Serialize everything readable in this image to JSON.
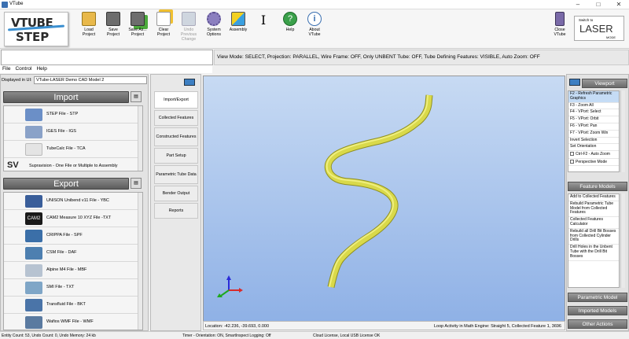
{
  "window": {
    "title": "VTube"
  },
  "logo": {
    "line1": "VTUBE",
    "line2": "STEP"
  },
  "toolbar": {
    "buttons": [
      {
        "line1": "Load",
        "line2": "Project",
        "disabled": false
      },
      {
        "line1": "Save",
        "line2": "Project",
        "disabled": false
      },
      {
        "line1": "Save As...",
        "line2": "Project",
        "disabled": false
      },
      {
        "line1": "Clear",
        "line2": "Project",
        "disabled": false
      },
      {
        "line1": "Undo",
        "line2": "Previous",
        "line3": "Change",
        "disabled": true
      },
      {
        "line1": "System",
        "line2": "Options",
        "disabled": false
      },
      {
        "line1": "Assembly",
        "line2": "",
        "disabled": false
      },
      {
        "line1": "I",
        "line2": "",
        "disabled": false
      },
      {
        "line1": "Help",
        "line2": "",
        "disabled": false
      },
      {
        "line1": "About",
        "line2": "VTube",
        "disabled": false
      }
    ],
    "close": {
      "line1": "Close",
      "line2": "VTube"
    },
    "switch_logo": {
      "top": "Switch to",
      "main": "LASER",
      "bottom": "MODE"
    }
  },
  "view_status": "View Mode: SELECT, Projection: PARALLEL, Wire Frame: OFF, Only UNBENT Tube: OFF, Tube Defining Features: VISIBLE, Auto Zoom: OFF",
  "menu": [
    "File",
    "Control",
    "Help"
  ],
  "displayed": {
    "label": "Displayed in UI:",
    "value": "VTube-LASER Demo CAD Model 2"
  },
  "import": {
    "title": "Import",
    "items": [
      {
        "label": "STEP File - STP",
        "color": "#6b8fc7"
      },
      {
        "label": "IGES File - IGS",
        "color": "#8aa2c8"
      },
      {
        "label": "TubeCalc File - TCA",
        "color": "#c9c9c9"
      },
      {
        "label": "Supravision - One File or Multiple to Assembly",
        "color": "#222222"
      }
    ]
  },
  "export": {
    "title": "Export",
    "items": [
      {
        "label": "UNISON Unibend v11 File - YBC",
        "color": "#3a5e9a"
      },
      {
        "label": "CAM2 Measure 10 XYZ File -TXT",
        "color": "#1a1a1a"
      },
      {
        "label": "CRIPPA File - SPF",
        "color": "#3b6fa8"
      },
      {
        "label": "CSM File - DAF",
        "color": "#4d7fb0"
      },
      {
        "label": "Alpine M4 File - MBF",
        "color": "#b7c3d1"
      },
      {
        "label": "SMI File - TXT",
        "color": "#7fa6c7"
      },
      {
        "label": "Transfluid File - BKT",
        "color": "#4a74a8"
      },
      {
        "label": "Wafios WMF File - WMF",
        "color": "#5a7aa0"
      }
    ]
  },
  "middle_tabs": [
    "Import/Export",
    "Collected Features",
    "Constructed Features",
    "Part Setup",
    "Parametric Tube Data",
    "Bender Output",
    "Reports"
  ],
  "viewport": {
    "location": "Location: -42.236, -39.693, 0.000",
    "loop": "Loop Activity in Math Engine: Straight 5, Collected Feature 1, 3696"
  },
  "viewport_panel": {
    "title": "Viewport",
    "items": [
      {
        "label": "F2 - Refresh Parametric Graphics",
        "highlight": true,
        "checkbox": false
      },
      {
        "label": "F3 - Zoom All",
        "highlight": false,
        "checkbox": false
      },
      {
        "label": "F4 - VPort: Select",
        "highlight": false,
        "checkbox": false
      },
      {
        "label": "F5 - VPort: Orbit",
        "highlight": false,
        "checkbox": false
      },
      {
        "label": "F6 - VPort: Pan",
        "highlight": false,
        "checkbox": false
      },
      {
        "label": "F7 - VPort: Zoom Win",
        "highlight": false,
        "checkbox": false
      },
      {
        "label": "Invert Selection",
        "highlight": false,
        "checkbox": false
      },
      {
        "label": "Set Orientation",
        "highlight": false,
        "checkbox": false
      },
      {
        "label": "Ctrl-F2 - Auto Zoom",
        "highlight": false,
        "checkbox": true
      },
      {
        "label": "Perspective Mode",
        "highlight": false,
        "checkbox": true
      }
    ]
  },
  "feature_panel": {
    "title": "Feature Models",
    "items": [
      "Add to Collected Features",
      "Rebuild Parametric Tube Model from Collected Features",
      "Collected Features Calculator",
      "Rebuild all Drill Bit Bosses from Collected Cylinder Drills",
      "Drill Holes in the Unbent Tube with the Drill Bit Bosses"
    ]
  },
  "bottom_right_headers": [
    "Parametric Model",
    "Imported Models",
    "Other Actions"
  ],
  "status": {
    "left": "Entity Count: 53, Undo Count: 0, Undo Memory: 24 kb",
    "mid": "Timer - Orientation: ON, SmartInspect Logging: Off",
    "right": "Cloud License, Local USB License OK"
  },
  "colors": {
    "tube": "#d6d645",
    "viewport_top": "#c7daf3",
    "viewport_bottom": "#8fb1e6"
  }
}
